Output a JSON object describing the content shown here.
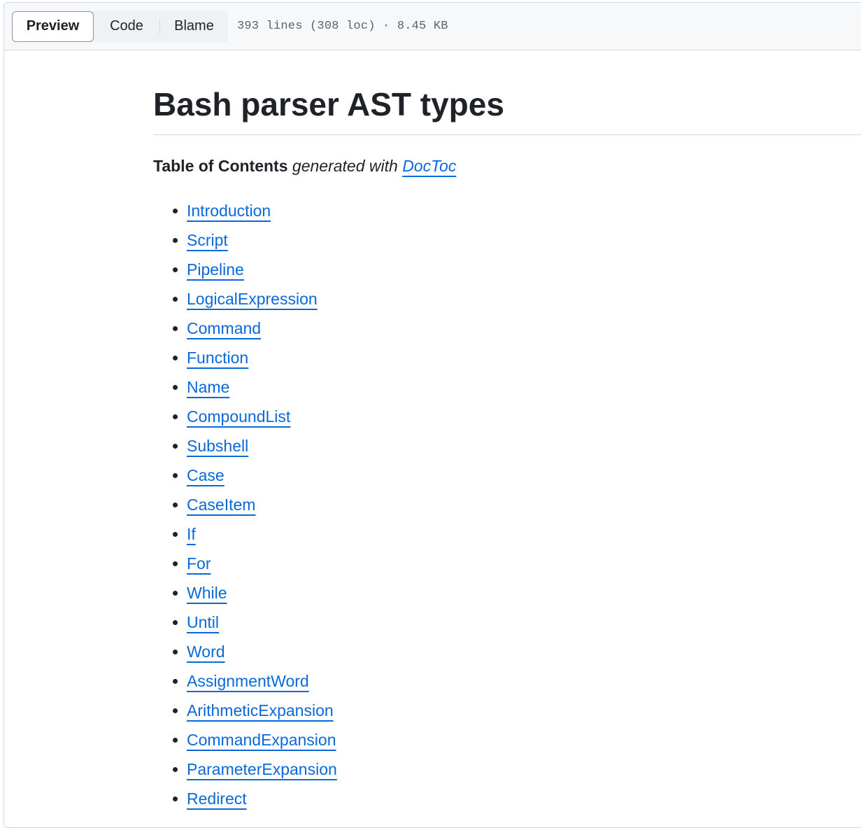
{
  "toolbar": {
    "tabs": {
      "preview": "Preview",
      "code": "Code",
      "blame": "Blame"
    },
    "file_meta": "393 lines (308 loc) · 8.45 KB"
  },
  "doc": {
    "title": "Bash parser AST types",
    "toc_intro": {
      "bold": "Table of Contents",
      "italic": "generated with",
      "link": "DocToc"
    },
    "toc_items": [
      "Introduction",
      "Script",
      "Pipeline",
      "LogicalExpression",
      "Command",
      "Function",
      "Name",
      "CompoundList",
      "Subshell",
      "Case",
      "CaseItem",
      "If",
      "For",
      "While",
      "Until",
      "Word",
      "AssignmentWord",
      "ArithmeticExpansion",
      "CommandExpansion",
      "ParameterExpansion",
      "Redirect"
    ]
  }
}
